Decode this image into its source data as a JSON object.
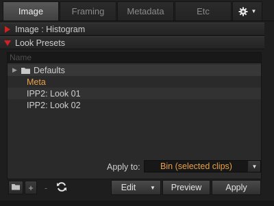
{
  "tabs": [
    {
      "label": "Image",
      "active": true
    },
    {
      "label": "Framing",
      "active": false
    },
    {
      "label": "Metadata",
      "active": false
    },
    {
      "label": "Etc",
      "active": false
    }
  ],
  "settings_menu": {
    "icon": "gear-icon"
  },
  "sections": {
    "histogram": {
      "label": "Image : Histogram",
      "expanded": false
    },
    "look_presets": {
      "label": "Look Presets",
      "expanded": true
    }
  },
  "presets": {
    "header": "Name",
    "items": [
      {
        "label": "Defaults",
        "type": "folder",
        "expanded": false
      },
      {
        "label": "Meta",
        "highlight_color": "#e8a24a"
      },
      {
        "label": "IPP2: Look 01"
      },
      {
        "label": "IPP2: Look 02"
      }
    ]
  },
  "apply_to": {
    "label": "Apply to:",
    "value": "Bin (selected clips)"
  },
  "toolbar": {
    "add_label": "+",
    "remove_label": "-",
    "edit_label": "Edit",
    "preview_label": "Preview",
    "apply_label": "Apply"
  },
  "colors": {
    "accent": "#e8a24a",
    "section_triangle": "#d32020"
  }
}
